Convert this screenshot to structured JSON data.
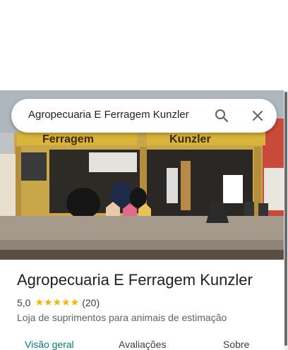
{
  "search": {
    "query": "Agropecuaria E Ferragem Kunzler"
  },
  "place": {
    "name": "Agropecuaria E Ferragem Kunzler",
    "rating": "5,0",
    "stars": "★★★★★",
    "review_count": "(20)",
    "category": "Loja de suprimentos para animais de estimação",
    "sign_left": "Ferragem",
    "sign_right": "Kunzler"
  },
  "tabs": [
    {
      "label": "Visão geral",
      "active": true
    },
    {
      "label": "Avaliações",
      "active": false
    },
    {
      "label": "Sobre",
      "active": false
    }
  ],
  "colors": {
    "accent": "#0b7a75",
    "star": "#f4b400",
    "sign": "#d9b43a"
  },
  "icons": {
    "search": "search-icon",
    "close": "close-icon"
  }
}
